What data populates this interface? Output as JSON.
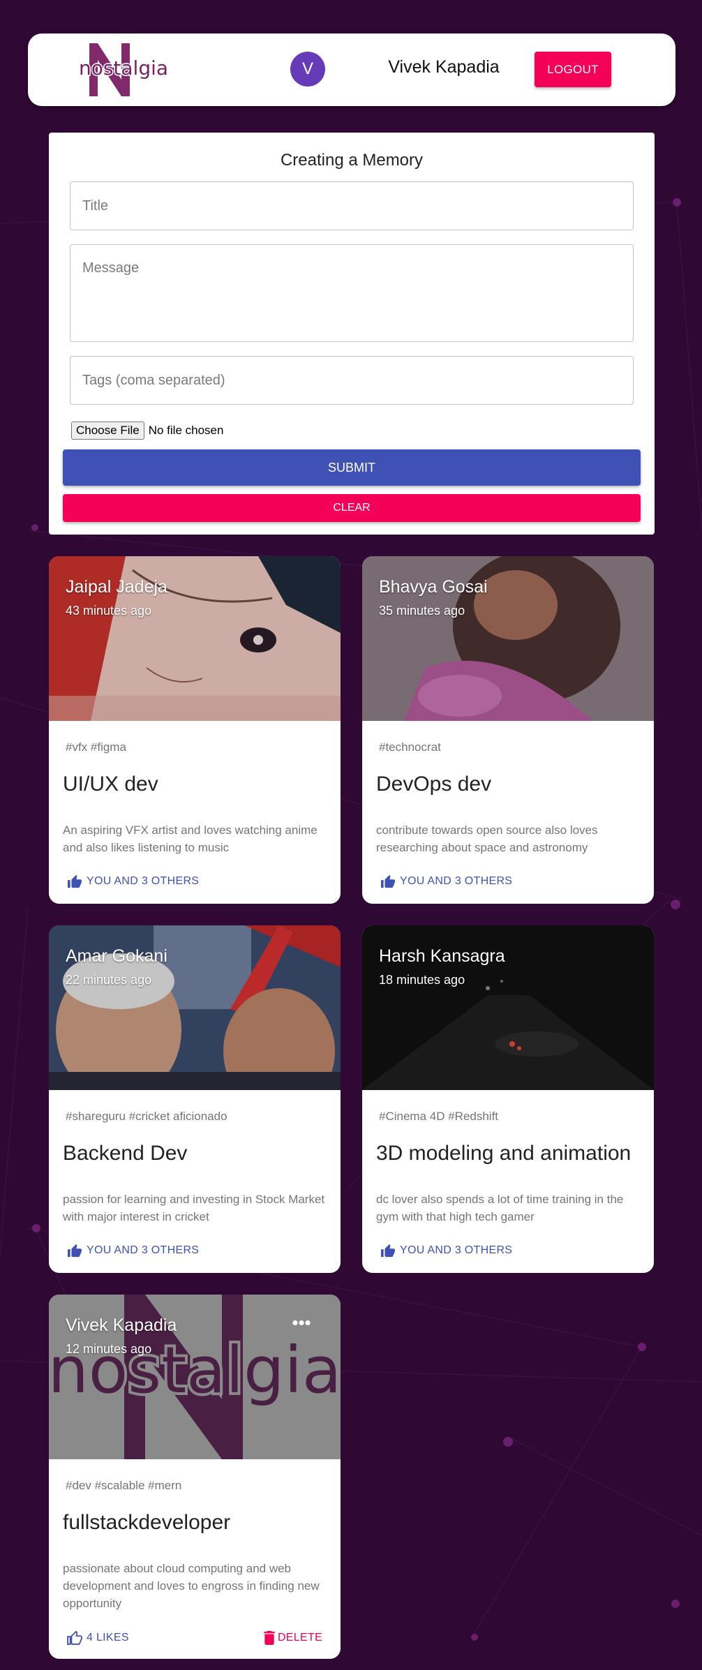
{
  "header": {
    "logo_text": "nostalgia",
    "avatar_letter": "V",
    "user_name": "Vivek Kapadia",
    "logout_label": "LOGOUT"
  },
  "form": {
    "heading": "Creating a Memory",
    "title_placeholder": "Title",
    "message_placeholder": "Message",
    "tags_placeholder": "Tags (coma separated)",
    "file_button_label": "Choose File",
    "file_status": "No file chosen",
    "submit_label": "SUBMIT",
    "clear_label": "CLEAR"
  },
  "posts": [
    {
      "author": "Jaipal Jadeja",
      "time": "43 minutes ago",
      "tags": "#vfx #figma",
      "title": "UI/UX dev",
      "message": "An aspiring VFX artist and loves watching anime and also likes listening to music",
      "like_label": "YOU AND 3 OTHERS"
    },
    {
      "author": "Bhavya Gosai",
      "time": "35 minutes ago",
      "tags": "#technocrat",
      "title": "DevOps dev",
      "message": "contribute towards open source also loves researching about space and astronomy",
      "like_label": "YOU AND 3 OTHERS"
    },
    {
      "author": "Amar Gokani",
      "time": "22 minutes ago",
      "tags": "#shareguru #cricket aficionado",
      "title": "Backend Dev",
      "message": "passion for learning and investing in Stock Market with major interest in cricket",
      "like_label": "YOU AND 3 OTHERS"
    },
    {
      "author": "Harsh Kansagra",
      "time": "18 minutes ago",
      "tags": "#Cinema 4D #Redshift",
      "title": "3D modeling and animation",
      "message": "dc lover also spends a lot of time training in the gym with that high tech gamer",
      "like_label": "YOU AND 3 OTHERS"
    },
    {
      "author": "Vivek Kapadia",
      "time": "12 minutes ago",
      "tags": "#dev #scalable #mern",
      "title": "fullstackdeveloper",
      "message": "passionate about cloud computing and web development and loves to engross in finding new opportunity",
      "like_label": "4 LIKES",
      "delete_label": "DELETE",
      "more_glyph": "•••",
      "media_logo_text": "nostalgia"
    }
  ],
  "colors": {
    "background": "#2f0833",
    "primary": "#3f51b5",
    "secondary": "#f50057",
    "avatar": "#673ab7",
    "logo": "#7a1f63"
  }
}
